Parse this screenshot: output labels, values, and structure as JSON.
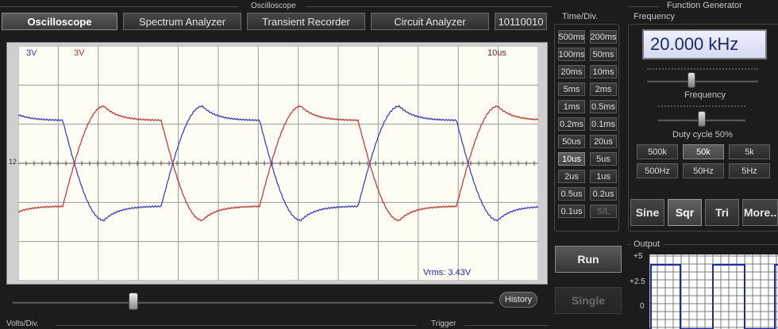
{
  "oscilloscope": {
    "section_title": "Oscilloscope",
    "tabs": [
      {
        "label": "Oscilloscope",
        "active": true
      },
      {
        "label": "Spectrum Analyzer",
        "active": false
      },
      {
        "label": "Transient Recorder",
        "active": false
      },
      {
        "label": "Circuit Analyzer",
        "active": false
      },
      {
        "label": "10110010",
        "active": false
      }
    ],
    "overlay": {
      "ch1_scale": "3V",
      "ch2_scale": "3V",
      "timebase": "10us",
      "measurement": "Vrms: 3.43V",
      "marker": "12"
    },
    "history_label": "History",
    "timebase_slider": {
      "position_fraction": 0.25
    },
    "volts_div_title": "Volts/Div.",
    "trigger_title": "Trigger"
  },
  "time_div": {
    "title": "Time/Div.",
    "buttons": [
      [
        "500ms",
        "200ms"
      ],
      [
        "100ms",
        "50ms"
      ],
      [
        "20ms",
        "10ms"
      ],
      [
        "5ms",
        "2ms"
      ],
      [
        "1ms",
        "0.5ms"
      ],
      [
        "0.2ms",
        "0.1ms"
      ],
      [
        "50us",
        "20us"
      ],
      [
        "10us",
        "5us"
      ],
      [
        "2us",
        "1us"
      ],
      [
        "0.5us",
        "0.2us"
      ],
      [
        "0.1us",
        "S/L"
      ]
    ],
    "selected": "10us",
    "disabled": "S/L"
  },
  "controls": {
    "run_label": "Run",
    "single_label": "Single",
    "single_enabled": false
  },
  "function_generator": {
    "section_title": "Function Generator",
    "frequency_title": "Frequency",
    "frequency_value": "20.000 kHz",
    "frequency_slider_label": "Frequency",
    "frequency_slider_fraction": 0.4,
    "duty_cycle_label": "Duty cycle 50%",
    "duty_cycle_fraction": 0.5,
    "range_buttons": [
      [
        "500k",
        "50k",
        "5k"
      ],
      [
        "500Hz",
        "50Hz",
        "5Hz"
      ]
    ],
    "selected_range": "50k",
    "waveforms": [
      {
        "label": "Sine",
        "active": false
      },
      {
        "label": "Sqr",
        "active": true
      },
      {
        "label": "Tri",
        "active": false
      },
      {
        "label": "More..",
        "active": false
      }
    ],
    "output": {
      "title": "Output",
      "y_labels": [
        "+5",
        "+2.5",
        "0"
      ]
    }
  },
  "colors": {
    "ch1": "#2f36c8",
    "ch2": "#c8302c",
    "output_wave": "#1e2aa6",
    "screen_bg": "#fdfdf4",
    "grid": "#9a9a9a"
  }
}
